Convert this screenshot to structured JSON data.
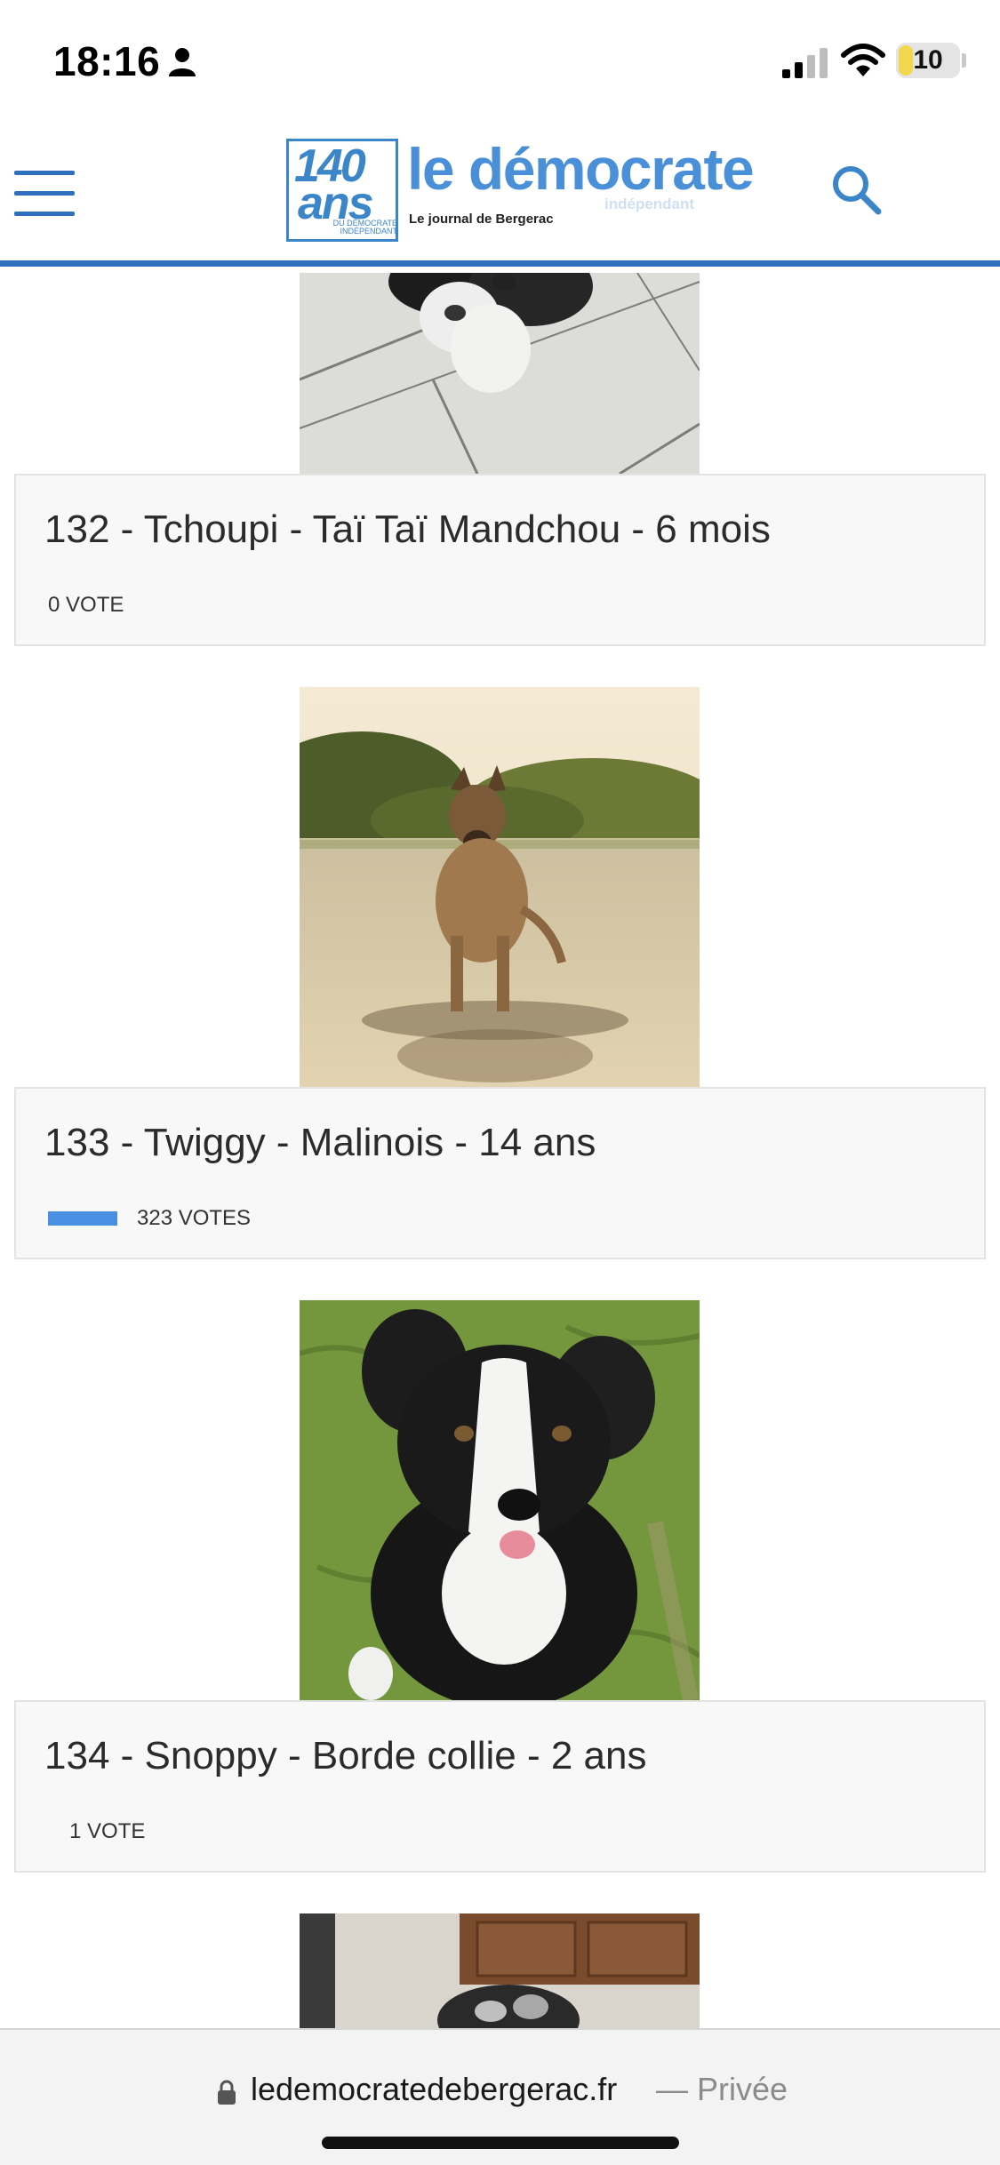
{
  "status_bar": {
    "time": "18:16",
    "battery_level": "10",
    "icons": [
      "person-icon",
      "signal-icon",
      "wifi-icon",
      "battery-icon"
    ]
  },
  "header": {
    "anniversary_number": "140",
    "anniversary_word": "ans",
    "anniversary_small": "DU DÉMOCRATE INDÉPENDANT",
    "title": "le démocrate",
    "tagline": "indépendant",
    "subtitle": "Le journal de Bergerac",
    "brand_color": "#2f6fbe",
    "icons": [
      "menu-icon",
      "search-icon"
    ]
  },
  "entries": [
    {
      "title": "132 - Tchoupi - Taï Taï Mandchou - 6 mois",
      "votes_label": "0 VOTE",
      "vote_share": 0.0
    },
    {
      "title": "133 - Twiggy - Malinois - 14 ans",
      "votes_label": "323 VOTES",
      "vote_share": 1.0
    },
    {
      "title": "134 - Snoppy - Borde collie - 2 ans",
      "votes_label": "1 VOTE",
      "vote_share": 0.0
    }
  ],
  "vote_bar_color": "#4a90e2",
  "browser": {
    "domain": "ledemocratedebergerac.fr",
    "mode": "— Privée"
  }
}
